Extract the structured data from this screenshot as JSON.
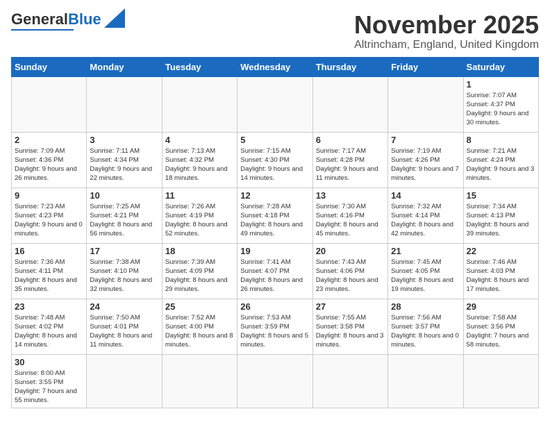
{
  "header": {
    "logo_text_normal": "General",
    "logo_text_blue": "Blue",
    "month_title": "November 2025",
    "location": "Altrincham, England, United Kingdom"
  },
  "weekdays": [
    "Sunday",
    "Monday",
    "Tuesday",
    "Wednesday",
    "Thursday",
    "Friday",
    "Saturday"
  ],
  "days": {
    "d1": {
      "num": "1",
      "sunrise": "7:07 AM",
      "sunset": "4:37 PM",
      "daylight": "9 hours and 30 minutes."
    },
    "d2": {
      "num": "2",
      "sunrise": "7:09 AM",
      "sunset": "4:36 PM",
      "daylight": "9 hours and 26 minutes."
    },
    "d3": {
      "num": "3",
      "sunrise": "7:11 AM",
      "sunset": "4:34 PM",
      "daylight": "9 hours and 22 minutes."
    },
    "d4": {
      "num": "4",
      "sunrise": "7:13 AM",
      "sunset": "4:32 PM",
      "daylight": "9 hours and 18 minutes."
    },
    "d5": {
      "num": "5",
      "sunrise": "7:15 AM",
      "sunset": "4:30 PM",
      "daylight": "9 hours and 14 minutes."
    },
    "d6": {
      "num": "6",
      "sunrise": "7:17 AM",
      "sunset": "4:28 PM",
      "daylight": "9 hours and 11 minutes."
    },
    "d7": {
      "num": "7",
      "sunrise": "7:19 AM",
      "sunset": "4:26 PM",
      "daylight": "9 hours and 7 minutes."
    },
    "d8": {
      "num": "8",
      "sunrise": "7:21 AM",
      "sunset": "4:24 PM",
      "daylight": "9 hours and 3 minutes."
    },
    "d9": {
      "num": "9",
      "sunrise": "7:23 AM",
      "sunset": "4:23 PM",
      "daylight": "9 hours and 0 minutes."
    },
    "d10": {
      "num": "10",
      "sunrise": "7:25 AM",
      "sunset": "4:21 PM",
      "daylight": "8 hours and 56 minutes."
    },
    "d11": {
      "num": "11",
      "sunrise": "7:26 AM",
      "sunset": "4:19 PM",
      "daylight": "8 hours and 52 minutes."
    },
    "d12": {
      "num": "12",
      "sunrise": "7:28 AM",
      "sunset": "4:18 PM",
      "daylight": "8 hours and 49 minutes."
    },
    "d13": {
      "num": "13",
      "sunrise": "7:30 AM",
      "sunset": "4:16 PM",
      "daylight": "8 hours and 45 minutes."
    },
    "d14": {
      "num": "14",
      "sunrise": "7:32 AM",
      "sunset": "4:14 PM",
      "daylight": "8 hours and 42 minutes."
    },
    "d15": {
      "num": "15",
      "sunrise": "7:34 AM",
      "sunset": "4:13 PM",
      "daylight": "8 hours and 39 minutes."
    },
    "d16": {
      "num": "16",
      "sunrise": "7:36 AM",
      "sunset": "4:11 PM",
      "daylight": "8 hours and 35 minutes."
    },
    "d17": {
      "num": "17",
      "sunrise": "7:38 AM",
      "sunset": "4:10 PM",
      "daylight": "8 hours and 32 minutes."
    },
    "d18": {
      "num": "18",
      "sunrise": "7:39 AM",
      "sunset": "4:09 PM",
      "daylight": "8 hours and 29 minutes."
    },
    "d19": {
      "num": "19",
      "sunrise": "7:41 AM",
      "sunset": "4:07 PM",
      "daylight": "8 hours and 26 minutes."
    },
    "d20": {
      "num": "20",
      "sunrise": "7:43 AM",
      "sunset": "4:06 PM",
      "daylight": "8 hours and 23 minutes."
    },
    "d21": {
      "num": "21",
      "sunrise": "7:45 AM",
      "sunset": "4:05 PM",
      "daylight": "8 hours and 19 minutes."
    },
    "d22": {
      "num": "22",
      "sunrise": "7:46 AM",
      "sunset": "4:03 PM",
      "daylight": "8 hours and 17 minutes."
    },
    "d23": {
      "num": "23",
      "sunrise": "7:48 AM",
      "sunset": "4:02 PM",
      "daylight": "8 hours and 14 minutes."
    },
    "d24": {
      "num": "24",
      "sunrise": "7:50 AM",
      "sunset": "4:01 PM",
      "daylight": "8 hours and 11 minutes."
    },
    "d25": {
      "num": "25",
      "sunrise": "7:52 AM",
      "sunset": "4:00 PM",
      "daylight": "8 hours and 8 minutes."
    },
    "d26": {
      "num": "26",
      "sunrise": "7:53 AM",
      "sunset": "3:59 PM",
      "daylight": "8 hours and 5 minutes."
    },
    "d27": {
      "num": "27",
      "sunrise": "7:55 AM",
      "sunset": "3:58 PM",
      "daylight": "8 hours and 3 minutes."
    },
    "d28": {
      "num": "28",
      "sunrise": "7:56 AM",
      "sunset": "3:57 PM",
      "daylight": "8 hours and 0 minutes."
    },
    "d29": {
      "num": "29",
      "sunrise": "7:58 AM",
      "sunset": "3:56 PM",
      "daylight": "7 hours and 58 minutes."
    },
    "d30": {
      "num": "30",
      "sunrise": "8:00 AM",
      "sunset": "3:55 PM",
      "daylight": "7 hours and 55 minutes."
    }
  }
}
